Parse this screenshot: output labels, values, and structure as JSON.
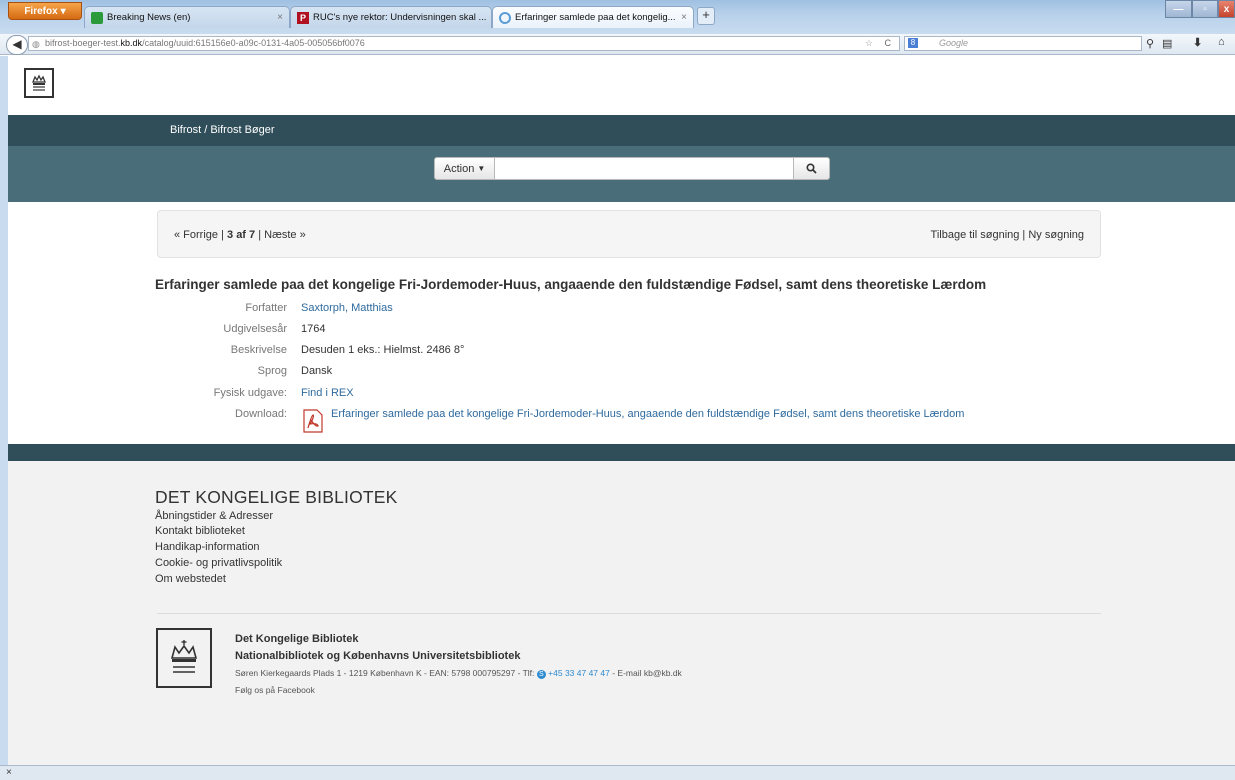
{
  "browser": {
    "menu_button": "Firefox",
    "tabs": [
      {
        "label": "Breaking News (en)"
      },
      {
        "label": "RUC's nye rektor: Undervisningen skal ..."
      },
      {
        "label": "Erfaringer samlede paa det kongelig..."
      }
    ],
    "url_prefix": "bifrost-boeger-test.",
    "url_domain": "kb.dk",
    "url_path": "/catalog/uuid:615156e0-a09c-0131-4a05-005056bf0076",
    "search_placeholder": "Google"
  },
  "header": {
    "breadcrumb": "Bifrost  /  Bifrost Bøger",
    "action_label": "Action"
  },
  "pager": {
    "prev": "« Forrige",
    "position": "3 af 7",
    "next": "Næste »",
    "back_to_search": "Tilbage til søgning",
    "new_search": "Ny søgning"
  },
  "record": {
    "title": "Erfaringer samlede paa det kongelige Fri-Jordemoder-Huus, angaaende den fuldstændige Fødsel, samt dens theoretiske Lærdom",
    "fields": [
      {
        "label": "Forfatter",
        "value": "Saxtorph, Matthias"
      },
      {
        "label": "Udgivelsesår",
        "value": "1764"
      },
      {
        "label": "Beskrivelse",
        "value": "Desuden 1 eks.: Hielmst. 2486 8°"
      },
      {
        "label": "Sprog",
        "value": "Dansk"
      },
      {
        "label": "Fysisk udgave:",
        "value": "Find i REX"
      },
      {
        "label": "Download:",
        "value": "Erfaringer samlede paa det kongelige Fri-Jordemoder-Huus, angaaende den fuldstændige Fødsel, samt dens theoretiske Lærdom"
      }
    ]
  },
  "footer": {
    "heading": "DET KONGELIGE BIBLIOTEK",
    "links": [
      "Åbningstider & Adresser",
      "Kontakt biblioteket",
      "Handikap-information",
      "Cookie- og privatlivspolitik",
      "Om webstedet"
    ],
    "org_name": "Det Kongelige Bibliotek",
    "org_subtitle": "Nationalbibliotek og Københavns Universitetsbibliotek",
    "address": "Søren Kierkegaards Plads 1 - 1219 København K - EAN: 5798 000795297 - Tlf:",
    "phone": "+45 33 47 47 47",
    "email": "- E-mail kb@kb.dk",
    "facebook": "Følg os på Facebook"
  },
  "colors": {
    "band_dark": "#2f4e59",
    "band_mid": "#4a6e79",
    "link": "#2e6a9e"
  }
}
